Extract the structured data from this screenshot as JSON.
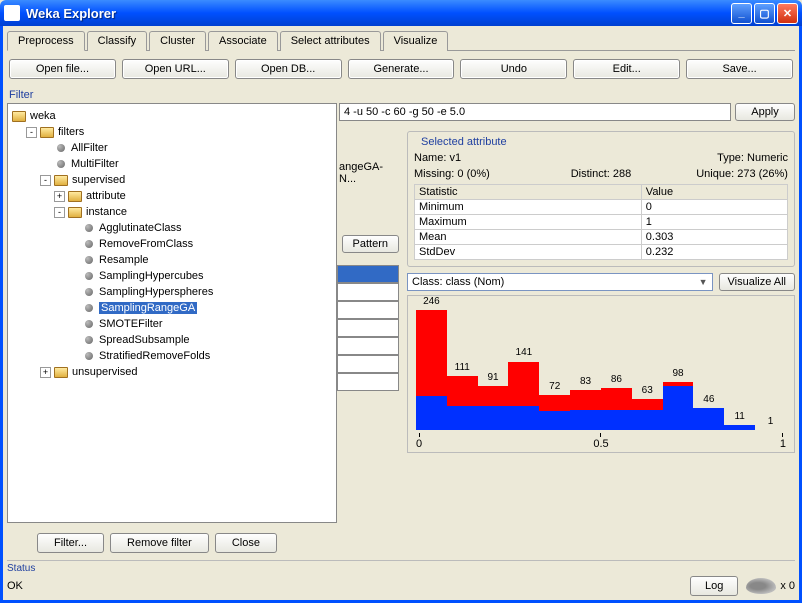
{
  "window": {
    "title": "Weka Explorer"
  },
  "tabs": [
    "Preprocess",
    "Classify",
    "Cluster",
    "Associate",
    "Select attributes",
    "Visualize"
  ],
  "top_buttons": [
    "Open file...",
    "Open URL...",
    "Open DB...",
    "Generate...",
    "Undo",
    "Edit...",
    "Save..."
  ],
  "filter": {
    "label": "Filter",
    "input_text": "4 -u 50 -c 60 -g 50 -e 5.0",
    "apply": "Apply",
    "partial_text": "angeGA-N..."
  },
  "tree": {
    "root": "weka",
    "filters": "filters",
    "all_filter": "AllFilter",
    "multi_filter": "MultiFilter",
    "supervised": "supervised",
    "attribute": "attribute",
    "instance": "instance",
    "instance_children": [
      "AgglutinateClass",
      "RemoveFromClass",
      "Resample",
      "SamplingHypercubes",
      "SamplingHyperspheres",
      "SamplingRangeGA",
      "SMOTEFilter",
      "SpreadSubsample",
      "StratifiedRemoveFolds"
    ],
    "unsupervised": "unsupervised"
  },
  "selected_attr": {
    "group_title": "Selected attribute",
    "name_label": "Name:",
    "name": "v1",
    "type_label": "Type:",
    "type": "Numeric",
    "missing_label": "Missing:",
    "missing": "0 (0%)",
    "distinct_label": "Distinct:",
    "distinct": "288",
    "unique_label": "Unique:",
    "unique": "273 (26%)",
    "stat_header_l": "Statistic",
    "stat_header_r": "Value",
    "stats": [
      {
        "k": "Minimum",
        "v": "0"
      },
      {
        "k": "Maximum",
        "v": "1"
      },
      {
        "k": "Mean",
        "v": "0.303"
      },
      {
        "k": "StdDev",
        "v": "0.232"
      }
    ]
  },
  "pattern_btn": "Pattern",
  "class_selector": "Class: class (Nom)",
  "viz_all": "Visualize All",
  "bottom_buttons": [
    "Filter...",
    "Remove filter",
    "Close"
  ],
  "status": {
    "label": "Status",
    "text": "OK",
    "log": "Log",
    "count": "x 0"
  },
  "chart_data": {
    "type": "bar",
    "title": "",
    "xlabel": "",
    "ylabel": "",
    "xticks": [
      "0",
      "0.5",
      "1"
    ],
    "categories": [
      "b0",
      "b1",
      "b2",
      "b3",
      "b4",
      "b5",
      "b6",
      "b7",
      "b8",
      "b9",
      "b10",
      "b11"
    ],
    "labels": [
      246,
      111,
      91,
      141,
      72,
      83,
      86,
      63,
      98,
      46,
      11,
      1
    ],
    "series": [
      {
        "name": "red",
        "values": [
          176,
          61,
          41,
          91,
          32,
          43,
          46,
          23,
          8,
          0,
          0,
          0
        ]
      },
      {
        "name": "blue",
        "values": [
          70,
          50,
          50,
          50,
          40,
          40,
          40,
          40,
          90,
          46,
          11,
          1
        ]
      }
    ],
    "ymax": 246
  }
}
